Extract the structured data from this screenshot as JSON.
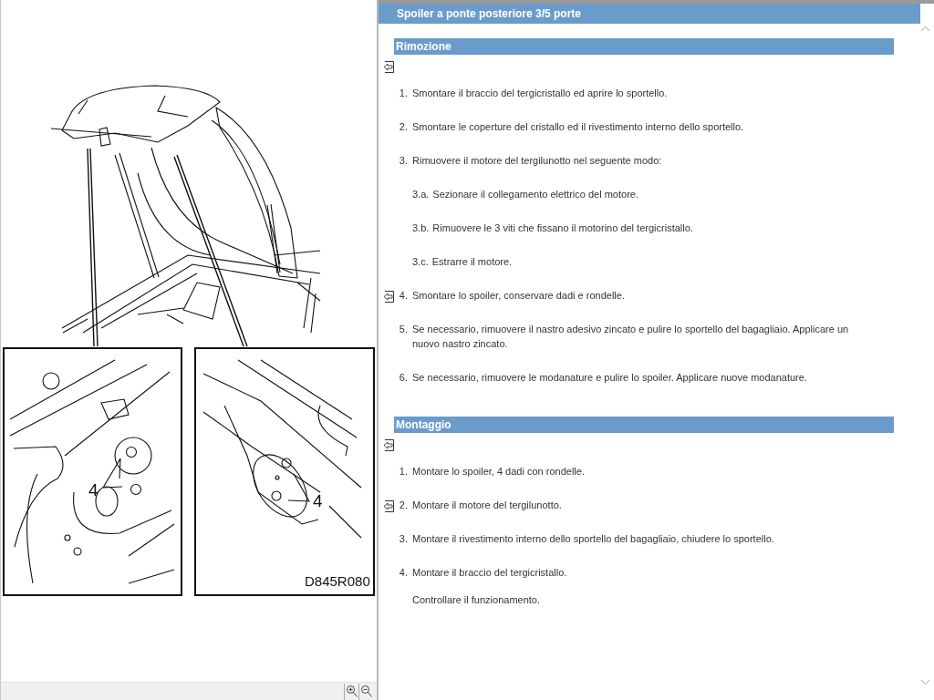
{
  "drawing": {
    "callouts": [
      "4",
      "4"
    ],
    "code": "D845R080"
  },
  "title": "Spoiler a ponte posteriore 3/5 porte",
  "sections": [
    {
      "heading": "Rimozione",
      "back_link": true,
      "steps": [
        {
          "kind": "step",
          "number": "1.",
          "text": "Smontare il braccio del tergicristallo ed aprire lo sportello.",
          "back_link": false
        },
        {
          "kind": "step",
          "number": "2.",
          "text": "Smontare le coperture del cristallo ed il rivestimento interno dello sportello.",
          "back_link": false
        },
        {
          "kind": "step",
          "number": "3.",
          "text": "Rimuovere il motore del tergilunotto nel seguente modo:",
          "back_link": false
        },
        {
          "kind": "substep",
          "number": "3.a.",
          "text": "Sezionare il collegamento elettrico del motore.",
          "back_link": false
        },
        {
          "kind": "substep",
          "number": "3.b.",
          "text": "Rimuovere le 3 viti che fissano il motorino del tergicristallo.",
          "back_link": false
        },
        {
          "kind": "substep",
          "number": "3.c.",
          "text": "Estrarre il motore.",
          "back_link": false
        },
        {
          "kind": "step",
          "number": "4.",
          "text": "Smontare lo spoiler, conservare dadi e rondelle.",
          "back_link": true
        },
        {
          "kind": "step",
          "number": "5.",
          "text": "Se necessario, rimuovere il nastro adesivo zincato e pulire lo sportello del bagagliaio. Applicare un nuovo nastro zincato.",
          "back_link": false
        },
        {
          "kind": "step",
          "number": "6.",
          "text": "Se necessario, rimuovere le modanature e pulire lo spoiler. Applicare nuove modanature.",
          "back_link": false
        }
      ]
    },
    {
      "heading": "Montaggio",
      "back_link": true,
      "steps": [
        {
          "kind": "step",
          "number": "1.",
          "text": "Montare lo spoiler, 4 dadi con rondelle.",
          "back_link": false
        },
        {
          "kind": "step",
          "number": "2.",
          "text": "Montare il motore del tergilunotto.",
          "back_link": true
        },
        {
          "kind": "step",
          "number": "3.",
          "text": "Montare il rivestimento interno dello sportello del bagagliaio, chiudere lo sportello.",
          "back_link": false
        },
        {
          "kind": "step",
          "number": "4.",
          "text": "Montare il braccio del tergicristallo.",
          "back_link": false
        },
        {
          "kind": "note",
          "text": "Controllare il funzionamento."
        }
      ]
    }
  ]
}
